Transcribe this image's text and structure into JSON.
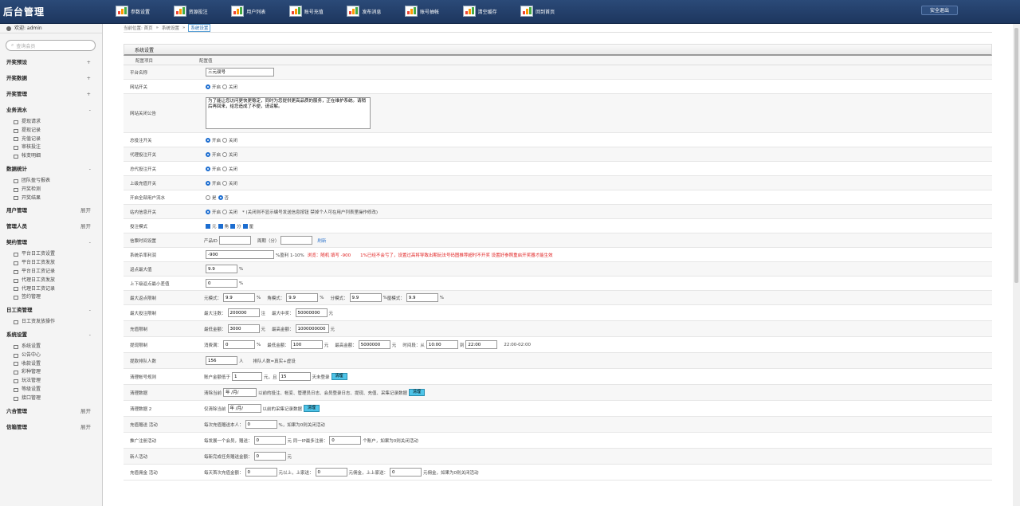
{
  "app": {
    "title": "后台管理",
    "logout_label": "安全退出"
  },
  "topnav": [
    {
      "label": "参数设置"
    },
    {
      "label": "资源投注"
    },
    {
      "label": "用户列表"
    },
    {
      "label": "账号充值"
    },
    {
      "label": "发布消息"
    },
    {
      "label": "账号抽帐"
    },
    {
      "label": "清空缓存"
    },
    {
      "label": "回到首页"
    }
  ],
  "sidebar": {
    "welcome": "欢迎: admin",
    "search_placeholder": "查询会员",
    "sections": [
      {
        "label": "开奖预设",
        "toggle": "+",
        "items": []
      },
      {
        "label": "开奖数据",
        "toggle": "+",
        "items": []
      },
      {
        "label": "开奖管理",
        "toggle": "+",
        "items": []
      },
      {
        "label": "业务流水",
        "toggle": "-",
        "items": [
          "提现请求",
          "提现记录",
          "充值记录",
          "审核投注",
          "帐变明细"
        ]
      },
      {
        "label": "数据统计",
        "toggle": "-",
        "items": [
          "团队盈亏报表",
          "开奖检测",
          "开奖结果"
        ]
      },
      {
        "label": "用户管理",
        "toggle": "展开",
        "items": []
      },
      {
        "label": "管理人员",
        "toggle": "展开",
        "items": []
      },
      {
        "label": "契约管理",
        "toggle": "-",
        "items": [
          "平台日工资设置",
          "平台日工资发放",
          "平台日工资记录",
          "代理日工资发放",
          "代理日工资记录",
          "签约管理"
        ]
      },
      {
        "label": "日工资管理",
        "toggle": "-",
        "items": [
          "日工资发放操作"
        ]
      },
      {
        "label": "系统设置",
        "toggle": "-",
        "items": [
          "系统设置",
          "公告中心",
          "收款设置",
          "彩种管理",
          "玩法管理",
          "等级设置",
          "接口管理"
        ]
      },
      {
        "label": "六合管理",
        "toggle": "展开",
        "items": []
      },
      {
        "label": "信箱管理",
        "toggle": "展开",
        "items": []
      }
    ]
  },
  "breadcrumb": {
    "prefix": "当前位置: 首页",
    "parent": "系统设置",
    "current": "系统设置"
  },
  "panel": {
    "title": "系统设置",
    "col_key": "配置项目",
    "col_val": "配置值"
  },
  "form": {
    "site_name_label": "平台名称",
    "site_name": "三元双号",
    "site_switch_label": "网站开关",
    "on": "开启",
    "off": "关闭",
    "close_notice_label": "网站关闭公告",
    "close_notice": "为了能让您访问更快更稳定，同时为您提供更高品质的服务，正在维护系统。请稍后再回来，给您造成了不便，请谅解。",
    "bet_switch_label": "总投注开关",
    "agent_bet_switch_label": "代理投注开关",
    "total_agent_bet_switch_label": "总代投注开关",
    "agent_recharge_switch_label": "上级充值开关",
    "user_flow_label": "开启全部用户流水",
    "yes": "是",
    "no": "否",
    "msg_switch_label": "站内信息开关",
    "msg_note": "* (关闭则不显示编号发送信息按钮 禁掉个人可在用户列表里操作修改)",
    "bet_mode_label": "投注模式",
    "modes": [
      "元",
      "角",
      "分",
      "厘"
    ],
    "lottery_timer_label": "信票时间设置",
    "product_id_label": "产品ID",
    "period_label": "周期（分）",
    "refresh_label": "刷新",
    "kill_ratio_label": "系统杀率利润",
    "kill_ratio": "-900",
    "kill_ratio_hint": "%盈利 1-10%",
    "kill_ratio_red1": "浏览：随机 填写 -900",
    "kill_ratio_red2": "1%已经不会亏了，设置过高将导致出期玩法号码图推荐超时不开奖 设置好参照重启开奖器才能生效",
    "rebate_max_label": "返点最大值",
    "rebate_max": "9.9",
    "pct": "%",
    "rebate_min_diff_label": "上下级返点最小差值",
    "rebate_min_diff": "0",
    "mode_rebate_label": "最大返点限制",
    "mode_yuan": "元模式：",
    "mode_jiao": "角模式：",
    "mode_fen": "分模式：",
    "mode_li": "厘模式：",
    "mode_val": "9.9",
    "max_bet_label": "最大投注限制",
    "max_bet_count_label": "最大注数：",
    "max_bet_count": "200000",
    "zhu": "注",
    "max_win_label": "最大中奖：",
    "max_win": "50000000",
    "yuan": "元",
    "recharge_limit_label": "充值限制",
    "min_amount_label": "最低金额：",
    "min_recharge": "3000",
    "max_amount_label": "最高金额：",
    "max_recharge": "1000000000",
    "withdraw_limit_label": "提现限制",
    "flow_full_label": "消费满：",
    "flow_full": "0",
    "min_withdraw": "100",
    "max_withdraw": "5000000",
    "time_label": "时间段：从",
    "time_from": "10:00",
    "to_label": "到",
    "time_to": "22:00",
    "time_range": "22:00-02:00",
    "withdraw_queue_label": "提款排队人数",
    "queue_count": "156",
    "person": "人",
    "queue_note": "排队人数=真实+虚设",
    "clean_account_label": "清理帐号规则",
    "balance_lt_label": "账户金额低于",
    "balance_lt": "1",
    "and_label": "元，且",
    "days": "15",
    "days_note": "天未登录",
    "clean_btn": "清理",
    "clean_data_label": "清理数据",
    "clean_before_label": "清除当前",
    "date_placeholder": "年 /月/",
    "clean_data_note": "以前的投注、帐变、管理员日志、会员登录日志、提现、充值、采集记录数据",
    "clean_data2_label": "清理数据 2",
    "keep_only_label": "仅清除当前",
    "clean_data2_note": "以前的采集记录数据",
    "recharge_promo_label": "充值赠送 活动",
    "recharge_promo_note1": "每次充值赠送本人：",
    "recharge_promo": "0",
    "recharge_promo_note2": "%，如果为0则关闭活动",
    "promo_label": "推广注册活动",
    "promo_note1": "每发展一个会员，赠送：",
    "promo_gift": "0",
    "promo_note2": "元   同一IP最多注册：",
    "promo_ip": "0",
    "promo_note3": "个账户，如果为0则关闭活动",
    "newbie_label": "新人活动",
    "newbie_note": "每新完成任务赠送金额：",
    "newbie": "0",
    "commission_label": "充值佣金 活动",
    "commission_note1": "每天首次充值金额：",
    "commission_a": "0",
    "commission_note2": "元以上，上家送：",
    "commission_b": "0",
    "commission_note3": "元佣金，上上家送：",
    "commission_c": "0",
    "commission_note4": "元佣金，如果为0则关闭活动"
  }
}
